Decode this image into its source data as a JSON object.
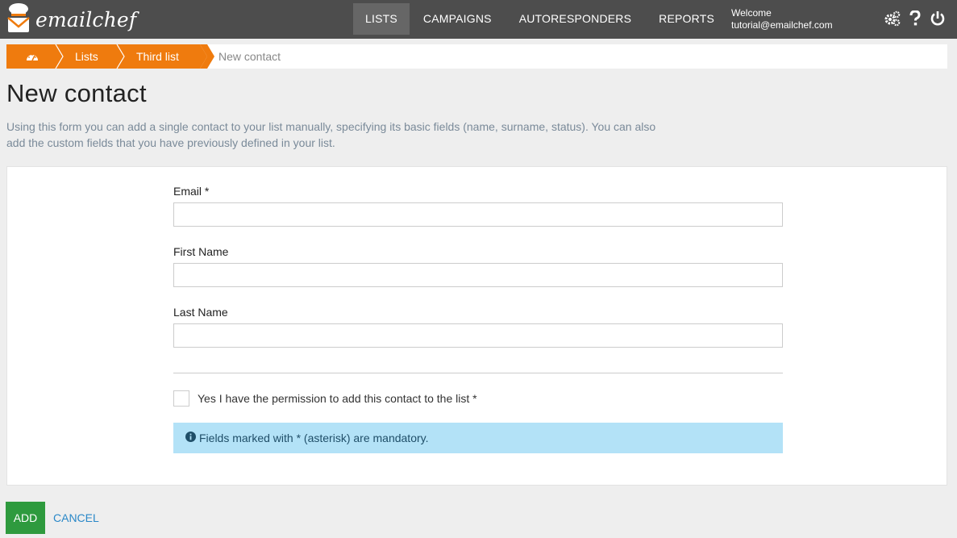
{
  "app": {
    "logo_text": "emailchef"
  },
  "nav": {
    "items": [
      {
        "label": "LISTS",
        "active": true
      },
      {
        "label": "CAMPAIGNS",
        "active": false
      },
      {
        "label": "AUTORESPONDERS",
        "active": false
      },
      {
        "label": "REPORTS",
        "active": false
      }
    ]
  },
  "user": {
    "welcome": "Welcome",
    "email": "tutorial@emailchef.com"
  },
  "top_icons": [
    "gears-icon",
    "help-icon",
    "power-icon"
  ],
  "breadcrumb": {
    "home_icon": "dashboard-icon",
    "items": [
      "Lists",
      "Third list"
    ],
    "current": "New contact"
  },
  "page": {
    "title": "New contact",
    "intro": "Using this form you can add a single contact to your list manually, specifying its basic fields (name, surname, status). You can also add the custom fields that you have previously defined in your list."
  },
  "form": {
    "email_label": "Email *",
    "email_value": "",
    "first_name_label": "First Name",
    "first_name_value": "",
    "last_name_label": "Last Name",
    "last_name_value": "",
    "permission_label": "Yes I have the permission to add this contact to the list *",
    "permission_checked": false,
    "mandatory_note": "Fields marked with * (asterisk) are mandatory."
  },
  "actions": {
    "add_label": "ADD",
    "cancel_label": "CANCEL"
  },
  "colors": {
    "topbar": "#4d4d4d",
    "breadcrumb_orange": "#ef7b0e",
    "add_green": "#2e9a3e",
    "info_blue": "#b3e2f7",
    "link_blue": "#2a88c8"
  }
}
